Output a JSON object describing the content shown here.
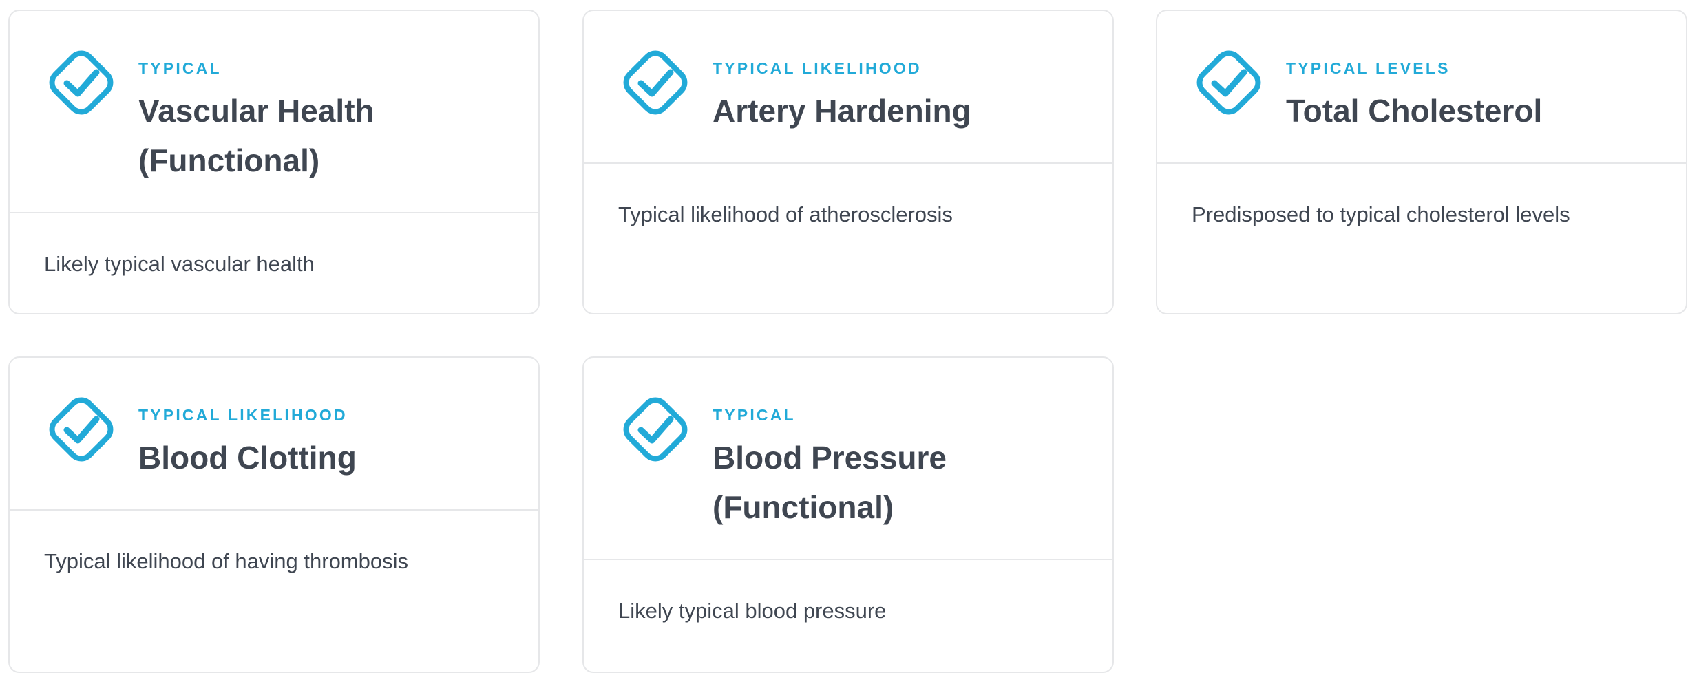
{
  "icon": {
    "name": "check-diamond-icon",
    "color": "#22aad8"
  },
  "colors": {
    "accent": "#22aad8",
    "text": "#3f4651",
    "border": "#e6e7e9"
  },
  "cards": [
    {
      "eyebrow": "TYPICAL",
      "title": "Vascular Health (Functional)",
      "description": "Likely typical vascular health"
    },
    {
      "eyebrow": "TYPICAL LIKELIHOOD",
      "title": "Artery Hardening",
      "description": "Typical likelihood of atherosclerosis"
    },
    {
      "eyebrow": "TYPICAL LEVELS",
      "title": "Total Cholesterol",
      "description": "Predisposed to typical cholesterol levels"
    },
    {
      "eyebrow": "TYPICAL LIKELIHOOD",
      "title": "Blood Clotting",
      "description": "Typical likelihood of having thrombosis"
    },
    {
      "eyebrow": "TYPICAL",
      "title": "Blood Pressure (Functional)",
      "description": "Likely typical blood pressure"
    }
  ]
}
